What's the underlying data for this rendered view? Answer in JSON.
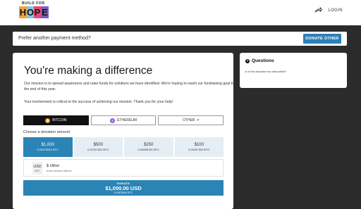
{
  "header": {
    "logo_top": "BUILD FOR",
    "logo_letters": [
      "H",
      "O",
      "P",
      "E"
    ],
    "login_icon": "login-arrow-icon",
    "login_label": "LOGIN"
  },
  "payment_bar": {
    "prompt": "Prefer another payment method?",
    "button_label": "DONATE OTHER"
  },
  "main": {
    "heading": "You're making a difference",
    "paragraph1": "Our mission is to spread awareness and raise funds for solutions we have identified. We're hoping to reach our fundraising goal by the end of this year.",
    "paragraph2": "Your involvement is critical to the success of achieving our mission. Thank you for your help!",
    "currency_tabs": [
      {
        "label": "BITCOIN",
        "icon": "bitcoin-icon",
        "icon_glyph": "₿",
        "active": true
      },
      {
        "label": "ETHEREUM",
        "icon": "ethereum-icon",
        "icon_glyph": "Ξ",
        "active": false
      },
      {
        "label": "OTHER",
        "caret": "▾",
        "active": false
      }
    ],
    "choose_label": "Choose a donation amount",
    "amounts": [
      {
        "usd": "$1,000",
        "btc": "0.02675044 BTC",
        "active": true
      },
      {
        "usd": "$500",
        "btc": "0.01337522 BTC",
        "active": false
      },
      {
        "usd": "$250",
        "btc": "0.00668761 BTC",
        "active": false
      },
      {
        "usd": "$100",
        "btc": "0.00267504 BTC",
        "active": false
      }
    ],
    "other": {
      "currency": "USD",
      "currency_sub": "BTC",
      "label": "$ Other",
      "hint": "enter amount above"
    },
    "donate": {
      "label": "DONATE",
      "amount": "$1,000.00 USD",
      "btc": "0.02675044 BTC"
    }
  },
  "questions": {
    "icon": "question-circle-icon",
    "title": "Questions",
    "items": [
      "Is this donation tax deductible?"
    ]
  },
  "colors": {
    "accent": "#2b84b6",
    "background": "#2b2b2b"
  }
}
